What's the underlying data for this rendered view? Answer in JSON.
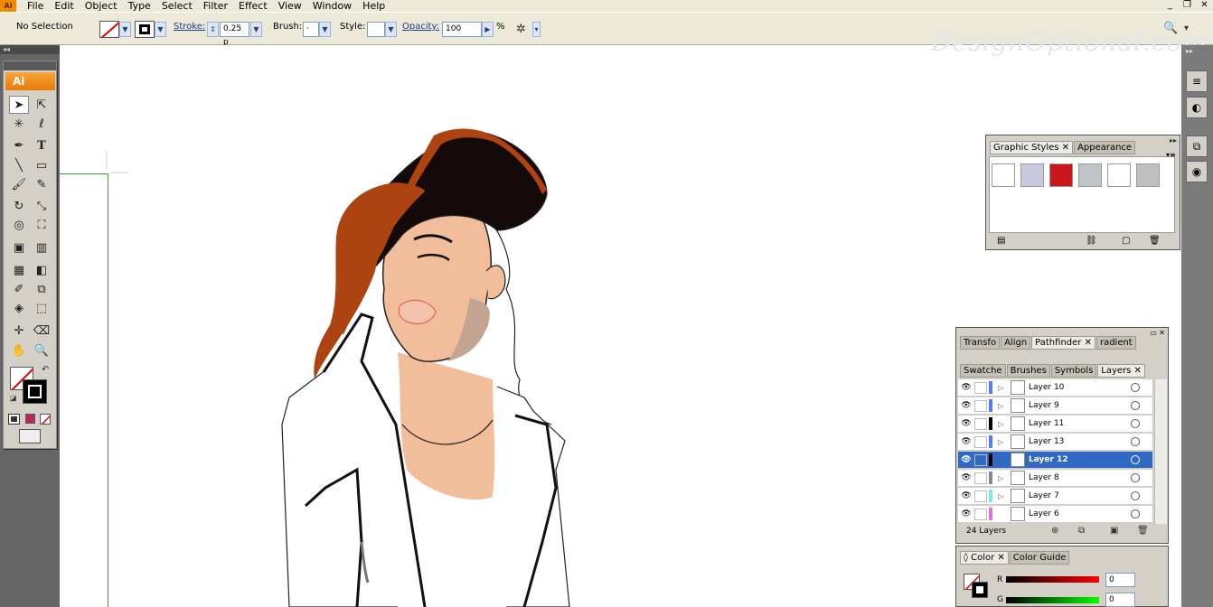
{
  "menu": {
    "logo": "Ai",
    "items": [
      "File",
      "Edit",
      "Object",
      "Type",
      "Select",
      "Filter",
      "Effect",
      "View",
      "Window",
      "Help"
    ]
  },
  "control": {
    "selection": "No Selection",
    "stroke_label": "Stroke:",
    "stroke_value": "0.25 p",
    "brush_label": "Brush:",
    "brush_value": "·",
    "style_label": "Style:",
    "opacity_label": "Opacity:",
    "opacity_value": "100",
    "percent": "%"
  },
  "toolbox": {
    "title": "Ai"
  },
  "watermark": "DesignOptional.com",
  "graphic_styles": {
    "tabs": [
      "Graphic Styles",
      "Appearance"
    ],
    "swatch_colors": [
      "#ffffff",
      "#c9c9df",
      "#c9161c",
      "#c0c3c7",
      "#ffffff",
      "#bfbfbf"
    ]
  },
  "pathfinder": {
    "tabs": [
      "Transfo",
      "Align",
      "Pathfinder",
      "radient"
    ]
  },
  "layers": {
    "tabs": [
      "Swatche",
      "Brushes",
      "Symbols",
      "Layers"
    ],
    "items": [
      {
        "name": "Layer 10",
        "color": "#5a7ce8"
      },
      {
        "name": "Layer 9",
        "color": "#5a7ce8"
      },
      {
        "name": "Layer 11",
        "color": "#000000"
      },
      {
        "name": "Layer 13",
        "color": "#5a7ce8"
      },
      {
        "name": "Layer 12",
        "color": "#000000"
      },
      {
        "name": "Layer 8",
        "color": "#888888"
      },
      {
        "name": "Layer 7",
        "color": "#7ee8e8"
      },
      {
        "name": "Layer 6",
        "color": "#e070e0"
      }
    ],
    "count": "24 Layers",
    "active": "Layer 12"
  },
  "color_panel": {
    "tabs": [
      "Color",
      "Color Guide"
    ],
    "r_label": "R",
    "r_value": "0",
    "g_label": "G",
    "g_value": "0"
  },
  "art_colors": {
    "skin": "#f2bd9a",
    "cap_brim": "#ae4312",
    "cap_crown": "#150a0a",
    "shadow": "#c3a491"
  }
}
